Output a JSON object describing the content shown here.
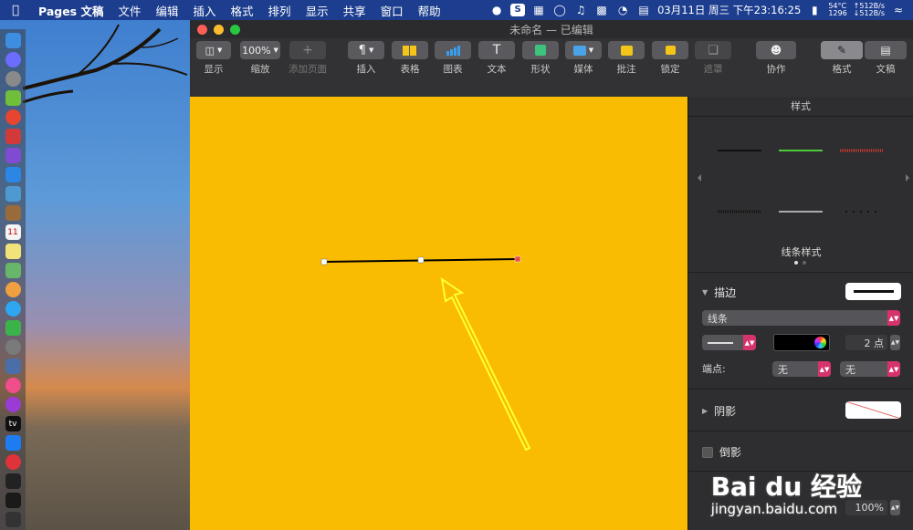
{
  "menubar": {
    "app_name": "Pages 文稿",
    "items": [
      "文件",
      "编辑",
      "插入",
      "格式",
      "排列",
      "显示",
      "共享",
      "窗口",
      "帮助"
    ],
    "datetime": "03月11日 周三 下午23:16:25",
    "temp": "54°C",
    "fan": "1296",
    "net_up": "↑512B/s",
    "net_down": "↓512B/s"
  },
  "window": {
    "title": "未命名 — 已编辑"
  },
  "toolbar": {
    "view_label": "显示",
    "zoom_value": "100%",
    "zoom_label": "缩放",
    "add_page_label": "添加页面",
    "insert_label": "插入",
    "table_label": "表格",
    "chart_label": "图表",
    "text_label": "文本",
    "shape_label": "形状",
    "media_label": "媒体",
    "comment_label": "批注",
    "lock_label": "锁定",
    "mask_label": "遮罩",
    "collab_label": "协作",
    "format_label": "格式",
    "document_label": "文稿"
  },
  "sidebar": {
    "header": "样式",
    "line_styles_label": "线条样式",
    "stroke_label": "描边",
    "stroke_type": "线条",
    "stroke_width": "2 点",
    "endpoints_label": "端点:",
    "endpoint_left": "无",
    "endpoint_right": "无",
    "shadow_label": "阴影",
    "reflection_label": "倒影",
    "opacity_value": "100%"
  },
  "watermark": {
    "brand": "Bai du 经验",
    "url": "jingyan.baidu.com"
  },
  "colors": {
    "canvas": "#f9bc00",
    "accent_pink": "#d6336c",
    "arrow": "#ffff33"
  }
}
